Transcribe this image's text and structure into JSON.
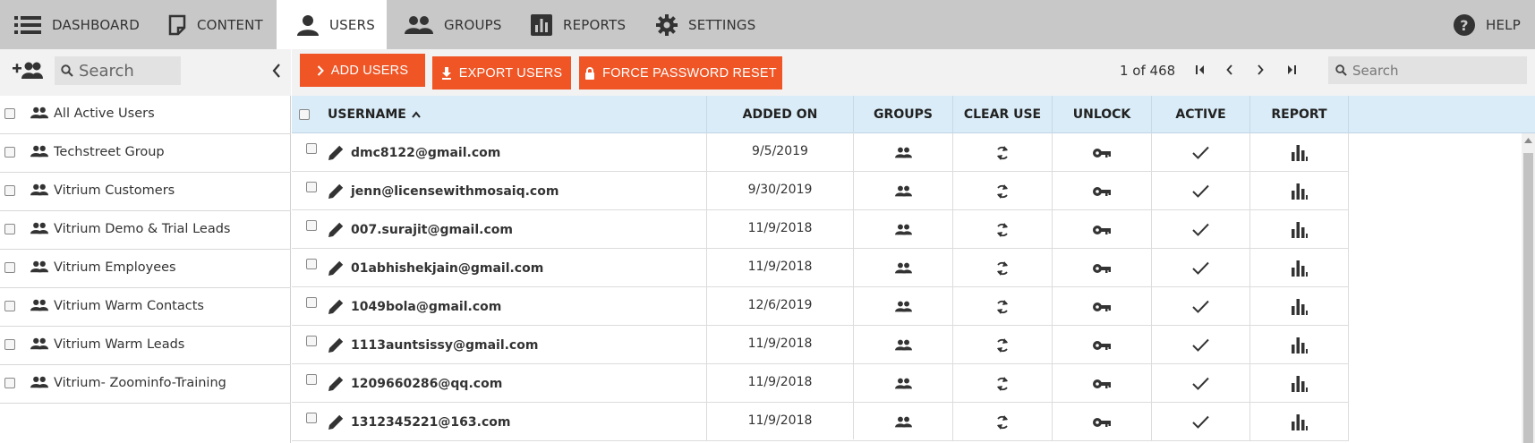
{
  "nav": {
    "dashboard": "DASHBOARD",
    "content": "CONTENT",
    "users": "USERS",
    "groups": "GROUPS",
    "reports": "REPORTS",
    "settings": "SETTINGS",
    "help": "HELP",
    "active_tab": "users"
  },
  "sidebar": {
    "search_placeholder": "Search",
    "groups": [
      {
        "label": "All Active Users"
      },
      {
        "label": "Techstreet Group"
      },
      {
        "label": "Vitrium Customers"
      },
      {
        "label": "Vitrium Demo & Trial Leads"
      },
      {
        "label": "Vitrium Employees"
      },
      {
        "label": "Vitrium Warm Contacts"
      },
      {
        "label": "Vitrium Warm Leads"
      },
      {
        "label": "Vitrium- Zoominfo-Training"
      }
    ]
  },
  "toolbar": {
    "add_users": "ADD USERS",
    "export_users": "EXPORT USERS",
    "force_password_reset": "FORCE PASSWORD RESET",
    "pager_text": "1 of 468",
    "search_placeholder": "Search"
  },
  "table": {
    "headers": {
      "username": "USERNAME",
      "added_on": "ADDED ON",
      "groups": "GROUPS",
      "clear_use": "CLEAR USE",
      "unlock": "UNLOCK",
      "active": "ACTIVE",
      "report": "REPORT"
    },
    "sort": {
      "column": "username",
      "direction": "ascending"
    },
    "rows": [
      {
        "username": "dmc8122@gmail.com",
        "added_on": "9/5/2019"
      },
      {
        "username": "jenn@licensewithmosaiq.com",
        "added_on": "9/30/2019"
      },
      {
        "username": "007.surajit@gmail.com",
        "added_on": "11/9/2018"
      },
      {
        "username": "01abhishekjain@gmail.com",
        "added_on": "11/9/2018"
      },
      {
        "username": "1049bola@gmail.com",
        "added_on": "12/6/2019"
      },
      {
        "username": "1113auntsissy@gmail.com",
        "added_on": "11/9/2018"
      },
      {
        "username": "1209660286@qq.com",
        "added_on": "11/9/2018"
      },
      {
        "username": "1312345221@163.com",
        "added_on": "11/9/2018"
      }
    ]
  },
  "colors": {
    "nav_bg": "#c8c8c8",
    "accent_orange": "#ef5525",
    "table_header_bg": "#d9ecf7",
    "toolbar_bg": "#f2f2f2"
  },
  "icons": {
    "dashboard": "list-icon",
    "content": "document-icon",
    "users": "person-icon",
    "groups": "people-icon",
    "reports": "bar-chart-icon",
    "settings": "gear-icon",
    "help": "help-circle-icon"
  }
}
